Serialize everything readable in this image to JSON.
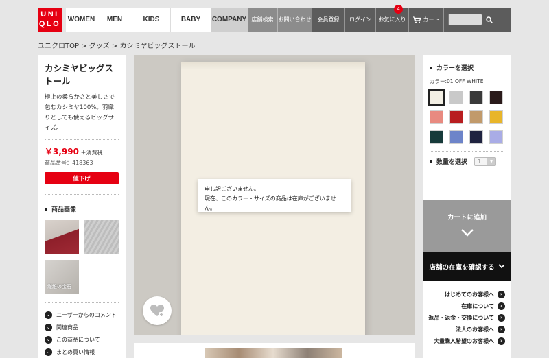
{
  "header": {
    "logo_line1": "UNI",
    "logo_line2": "QLO",
    "nav_main": [
      "WOMEN",
      "MEN",
      "KIDS",
      "BABY"
    ],
    "nav_company": "COMPANY",
    "nav_grey": [
      "店舗検索",
      "お問い合わせ"
    ],
    "nav_dark": [
      "会員登録",
      "ログイン",
      "お気に入り",
      "カート"
    ],
    "fav_count": "4"
  },
  "breadcrumb": "ユニクロTOP > グッズ > カシミヤビッグストール",
  "product": {
    "name": "カシミヤビッグストール",
    "description": "極上の柔らかさと美しさで包むカシミヤ100%。羽織りとしても使えるビッグサイズ。",
    "price": "￥3,990",
    "tax": "＋消費税",
    "code": "商品番号：418363",
    "sale_label": "値下げ"
  },
  "left": {
    "images_title": "商品画像",
    "thumb3_text": "繊維の宝石",
    "links": [
      "ユーザーからのコメント",
      "関連商品",
      "この商品について",
      "まとめ買い情報"
    ]
  },
  "popup": {
    "line1": "申し訳ございません。",
    "line2": "現在、このカラー・サイズの商品は在庫がございません。"
  },
  "right": {
    "color_title": "カラーを選択",
    "color_selected": "カラー:01 OFF WHITE",
    "swatches": [
      "#f3efe4",
      "#c9c9c9",
      "#3a3a3a",
      "#2a1a1a",
      "#e88a80",
      "#b81d20",
      "#c19a6b",
      "#e8b52a",
      "#163a3a",
      "#6d84c9",
      "#1f2340",
      "#a9ace6"
    ],
    "qty_title": "数量を選択",
    "qty_value": "1",
    "cart_label": "カートに追加",
    "store_label": "店舗の在庫を確認する",
    "help_links": [
      "はじめてのお客様へ",
      "在庫について",
      "返品・返金・交換について",
      "法人のお客様へ",
      "大量購入希望のお客様へ"
    ]
  }
}
